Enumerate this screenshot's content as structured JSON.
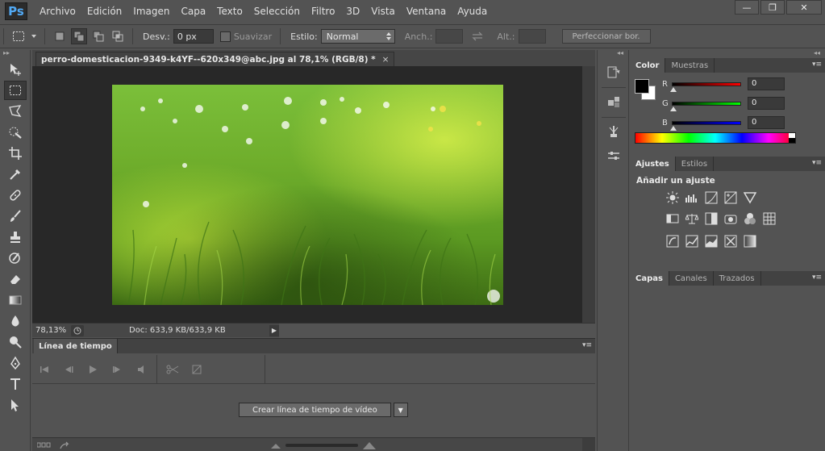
{
  "app": {
    "logo": "Ps",
    "menu": [
      "Archivo",
      "Edición",
      "Imagen",
      "Capa",
      "Texto",
      "Selección",
      "Filtro",
      "3D",
      "Vista",
      "Ventana",
      "Ayuda"
    ],
    "window_controls": {
      "minimize": "—",
      "restore": "❐",
      "close": "✕"
    }
  },
  "options_bar": {
    "feather_label": "Desv.:",
    "feather_value": "0 px",
    "antialias_label": "Suavizar",
    "style_label": "Estilo:",
    "style_value": "Normal",
    "width_label": "Anch.:",
    "height_label": "Alt.:",
    "refine_button": "Perfeccionar bor."
  },
  "toolbar": {
    "collapse": "▸▸",
    "tools": [
      "move-tool",
      "marquee-tool",
      "lasso-tool",
      "quick-selection-tool",
      "crop-tool",
      "eyedropper-tool",
      "healing-brush-tool",
      "brush-tool",
      "clone-stamp-tool",
      "history-brush-tool",
      "eraser-tool",
      "gradient-tool",
      "blur-tool",
      "dodge-tool",
      "pen-tool",
      "type-tool",
      "path-selection-tool"
    ],
    "selected": "marquee-tool"
  },
  "document": {
    "tab_title": "perro-domesticacion-9349-k4YF--620x349@abc.jpg al 78,1% (RGB/8) *",
    "tab_close": "×",
    "zoom": "78,13%",
    "doc_info": "Doc: 633,9 KB/633,9 KB",
    "status_arrow": "▶"
  },
  "timeline": {
    "tab": "Línea de tiempo",
    "menu": "▾≡",
    "create_button": "Crear línea de tiempo de vídeo",
    "dropdown": "▼"
  },
  "panels": {
    "collapse": "◂◂",
    "color": {
      "tabs": [
        "Color",
        "Muestras"
      ],
      "menu": "▾≡",
      "channels": [
        {
          "label": "R",
          "value": "0",
          "gradient": "linear-gradient(to right,#000,#ff0000)"
        },
        {
          "label": "G",
          "value": "0",
          "gradient": "linear-gradient(to right,#000,#00ff00)"
        },
        {
          "label": "B",
          "value": "0",
          "gradient": "linear-gradient(to right,#000,#0000ff)"
        }
      ],
      "foreground": "#000000",
      "background": "#ffffff"
    },
    "adjustments": {
      "tabs": [
        "Ajustes",
        "Estilos"
      ],
      "menu": "▾≡",
      "title": "Añadir un ajuste"
    },
    "layers": {
      "tabs": [
        "Capas",
        "Canales",
        "Trazados"
      ],
      "menu": "▾≡"
    }
  }
}
